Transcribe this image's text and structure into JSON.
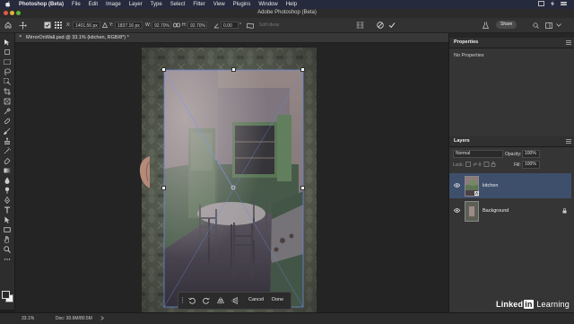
{
  "menubar": {
    "app_name": "Photoshop (Beta)",
    "items": [
      "File",
      "Edit",
      "Image",
      "Layer",
      "Type",
      "Select",
      "Filter",
      "View",
      "Plugins",
      "Window",
      "Help"
    ]
  },
  "titlebar": {
    "title": "Adobe Photoshop (Beta)"
  },
  "options": {
    "x_label": "X:",
    "x_value": "1401.56 px",
    "y_label": "Y:",
    "y_value": "1837.16 px",
    "w_label": "W:",
    "w_value": "92.70%",
    "h_label": "H:",
    "h_value": "92.70%",
    "angle_value": "0.00",
    "angle_unit": "°",
    "interp_placeholder": "Soft ideas",
    "share_label": "Share"
  },
  "document": {
    "tab_label": "MirrorOnWall.psd @ 33.1% (kitchen, RGB/8*) *",
    "close_glyph": "×"
  },
  "context_bar": {
    "cancel_label": "Cancel",
    "done_label": "Done"
  },
  "properties": {
    "tab_label": "Properties",
    "empty_text": "No Properties"
  },
  "layers": {
    "tab_label": "Layers",
    "blend_mode": "Normal",
    "opacity_label": "Opacity:",
    "opacity_value": "100%",
    "lock_label": "Lock:",
    "fill_label": "Fill:",
    "fill_value": "100%",
    "items": [
      {
        "name": "kitchen",
        "selected": true
      },
      {
        "name": "Background",
        "selected": false,
        "locked": true
      }
    ]
  },
  "status": {
    "zoom": "33.1%",
    "doc_info": "Doc: 30.6M/80.5M"
  },
  "watermark": {
    "part1": "Linked",
    "part2": "in",
    "part3": " Learning"
  },
  "colors": {
    "accent_selection": "#3d4f6b",
    "transform_box": "#6a86d8"
  }
}
